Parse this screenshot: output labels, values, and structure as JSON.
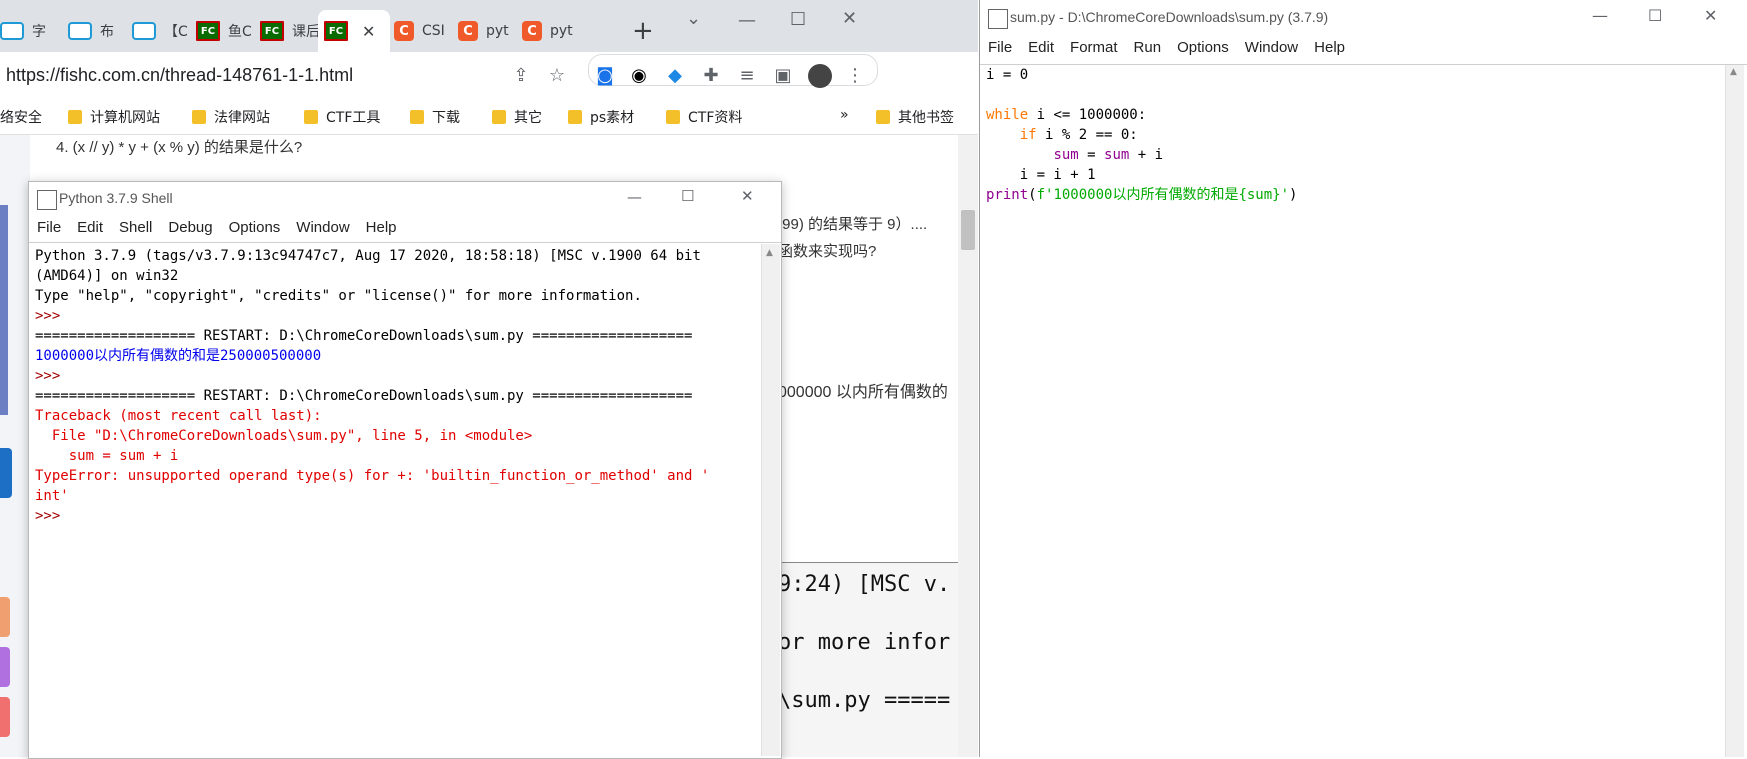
{
  "browser": {
    "tabs": [
      {
        "label": "字",
        "icon": "bilibili-icon"
      },
      {
        "label": "布",
        "icon": "bilibili-icon"
      },
      {
        "label": "【C",
        "icon": "bilibili-icon"
      },
      {
        "label": "鱼C",
        "icon": "fishc-icon"
      },
      {
        "label": "课后",
        "icon": "fishc-icon"
      },
      {
        "label": "",
        "icon": "fishc-icon",
        "active": true
      },
      {
        "label": "CSI",
        "icon": "csdn-icon"
      },
      {
        "label": "pyt",
        "icon": "csdn-icon"
      },
      {
        "label": "pyt",
        "icon": "csdn-icon"
      }
    ],
    "fav_fc": "FC",
    "fav_c": "C",
    "new_tab": "+",
    "close_tab": "✕",
    "url": "https://fishc.com.cn/thread-148761-1-1.html",
    "bookmarks": [
      {
        "label": "络安全",
        "folder": false
      },
      {
        "label": "计算机网站",
        "folder": true
      },
      {
        "label": "法律网站",
        "folder": true
      },
      {
        "label": "CTF工具",
        "folder": true
      },
      {
        "label": "下载",
        "folder": true
      },
      {
        "label": "其它",
        "folder": true
      },
      {
        "label": "ps素材",
        "folder": true
      },
      {
        "label": "CTF资料",
        "folder": true
      }
    ],
    "bookmarks_more": "»",
    "other_bookmarks": "其他书签",
    "page": {
      "question4": "4. (x // y) * y + (x % y) 的结果是什么?",
      "frag1": ".99) 的结果等于 9）....",
      "frag2": "函数来实现吗?",
      "frag3": "000000 以内所有偶数的",
      "term1": "9:24) [MSC v.",
      "term2": "or more infor",
      "term3": "\\sum.py ====="
    }
  },
  "shell": {
    "title": "Python 3.7.9 Shell",
    "menu": [
      "File",
      "Edit",
      "Shell",
      "Debug",
      "Options",
      "Window",
      "Help"
    ],
    "lines": [
      {
        "text": "Python 3.7.9 (tags/v3.7.9:13c94747c7, Aug 17 2020, 18:58:18) [MSC v.1900 64 bit",
        "color": "#000000"
      },
      {
        "text": "(AMD64)] on win32",
        "color": "#000000"
      },
      {
        "text": "Type \"help\", \"copyright\", \"credits\" or \"license()\" for more information.",
        "color": "#000000"
      },
      {
        "text": ">>> ",
        "color": "#a00000"
      },
      {
        "text": "=================== RESTART: D:\\ChromeCoreDownloads\\sum.py ===================",
        "color": "#000000"
      },
      {
        "text": "1000000以内所有偶数的和是250000500000",
        "color": "#0000ee"
      },
      {
        "text": ">>> ",
        "color": "#a00000"
      },
      {
        "text": "=================== RESTART: D:\\ChromeCoreDownloads\\sum.py ===================",
        "color": "#000000"
      },
      {
        "text": "Traceback (most recent call last):",
        "color": "#e00000"
      },
      {
        "text": "  File \"D:\\ChromeCoreDownloads\\sum.py\", line 5, in <module>",
        "color": "#e00000"
      },
      {
        "text": "    sum = sum + i",
        "color": "#e00000"
      },
      {
        "text": "TypeError: unsupported operand type(s) for +: 'builtin_function_or_method' and '",
        "color": "#e00000"
      },
      {
        "text": "int'",
        "color": "#e00000"
      },
      {
        "text": ">>> ",
        "color": "#a00000"
      }
    ]
  },
  "editor": {
    "title": "sum.py - D:\\ChromeCoreDownloads\\sum.py (3.7.9)",
    "menu": [
      "File",
      "Edit",
      "Format",
      "Run",
      "Options",
      "Window",
      "Help"
    ],
    "code": [
      [
        {
          "t": "i = 0",
          "c": "#000000"
        }
      ],
      [
        {
          "t": "",
          "c": "#000000"
        }
      ],
      [
        {
          "t": "while",
          "c": "#ff7700"
        },
        {
          "t": " i <= 1000000:",
          "c": "#000000"
        }
      ],
      [
        {
          "t": "    ",
          "c": "#000000"
        },
        {
          "t": "if",
          "c": "#ff7700"
        },
        {
          "t": " i % 2 == 0:",
          "c": "#000000"
        }
      ],
      [
        {
          "t": "        ",
          "c": "#000000"
        },
        {
          "t": "sum",
          "c": "#900090"
        },
        {
          "t": " = ",
          "c": "#000000"
        },
        {
          "t": "sum",
          "c": "#900090"
        },
        {
          "t": " + i",
          "c": "#000000"
        }
      ],
      [
        {
          "t": "    i = i + 1",
          "c": "#000000"
        }
      ],
      [
        {
          "t": "print",
          "c": "#900090"
        },
        {
          "t": "(",
          "c": "#000000"
        },
        {
          "t": "f'1000000以内所有偶数的和是{sum}'",
          "c": "#00aa00"
        },
        {
          "t": ")",
          "c": "#000000"
        }
      ]
    ]
  },
  "icons": {
    "minimize": "—",
    "maximize": "☐",
    "close": "✕",
    "chevron": "⌄"
  },
  "colors": {
    "tabstrip": "#dee1e6",
    "idle_keyword": "#ff7700",
    "idle_builtin": "#900090",
    "idle_string": "#00aa00",
    "idle_error": "#e00000",
    "idle_output": "#0000ee"
  }
}
